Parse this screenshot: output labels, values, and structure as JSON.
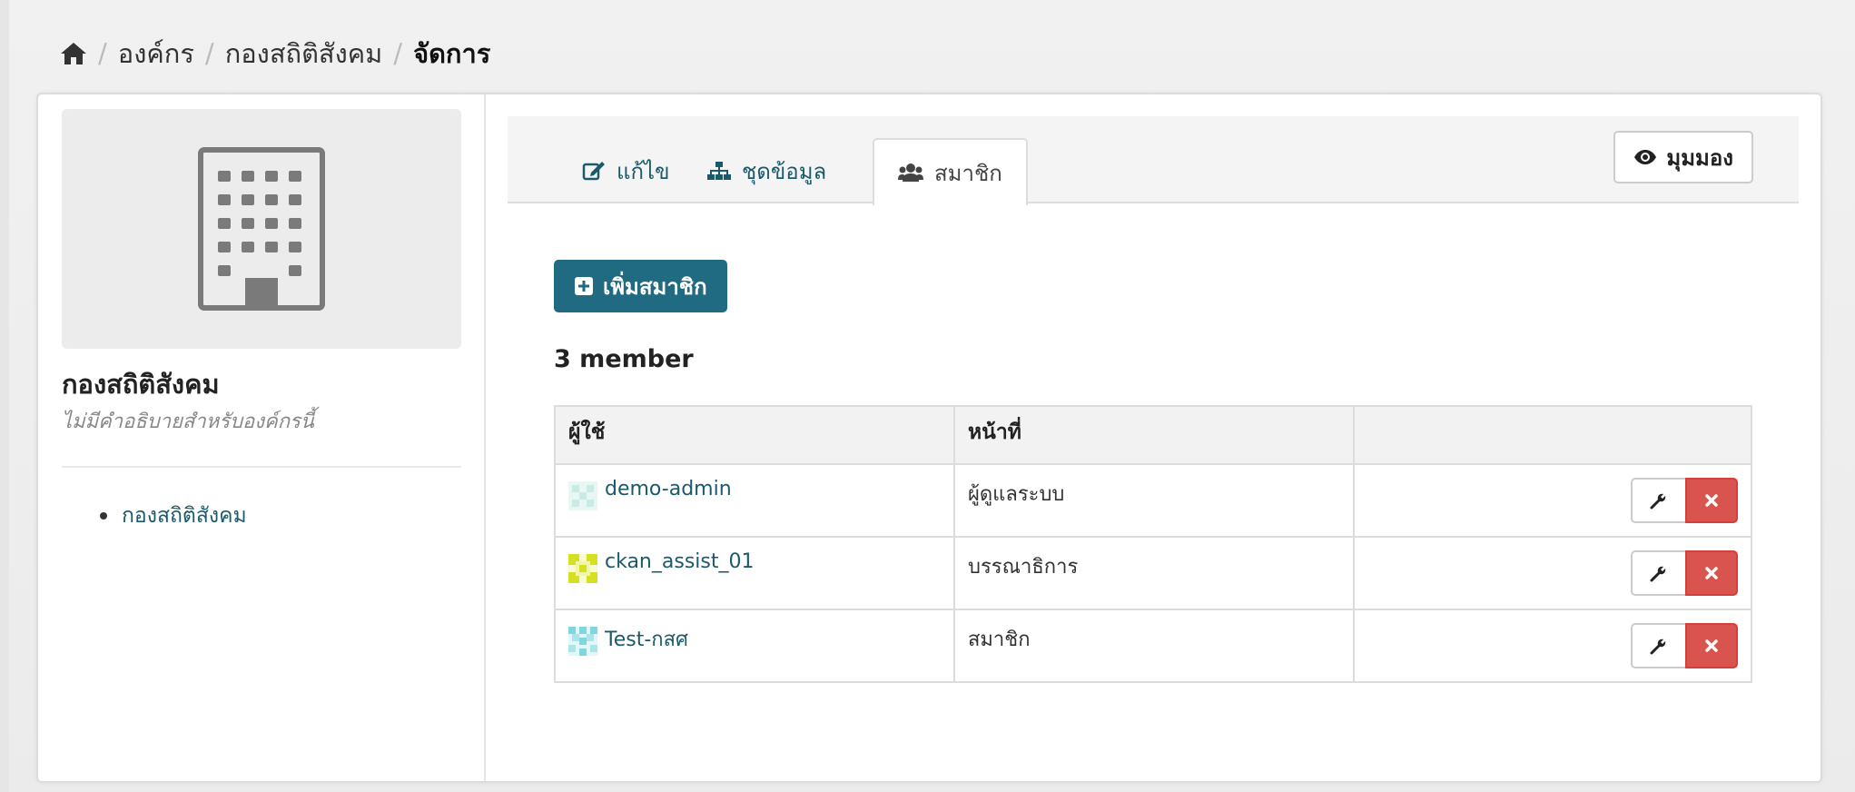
{
  "breadcrumb": {
    "home_icon": "home-icon",
    "items": [
      "องค์กร",
      "กองสถิติสังคม",
      "จัดการ"
    ]
  },
  "sidebar": {
    "org_image_icon": "building-icon",
    "org_title": "กองสถิติสังคม",
    "org_description": "ไม่มีคำอธิบายสำหรับองค์กรนี้",
    "links": [
      "กองสถิติสังคม"
    ]
  },
  "tabs": [
    {
      "label": "แก้ไข",
      "icon": "edit-icon",
      "active": false
    },
    {
      "label": "ชุดข้อมูล",
      "icon": "sitemap-icon",
      "active": false
    },
    {
      "label": "สมาชิก",
      "icon": "users-icon",
      "active": true
    }
  ],
  "view_button": {
    "label": "มุมมอง",
    "icon": "eye-icon"
  },
  "add_member_button": {
    "label": "เพิ่มสมาชิก",
    "icon": "plus-square-icon"
  },
  "member_count": "3 member",
  "table": {
    "headers": [
      "ผู้ใช้",
      "หน้าที่",
      ""
    ],
    "rows": [
      {
        "user": "demo-admin",
        "role": "ผู้ดูแลระบบ"
      },
      {
        "user": "ckan_assist_01",
        "role": "บรรณาธิการ"
      },
      {
        "user": "Test-กสศ",
        "role": "สมาชิก"
      }
    ],
    "edit_icon": "wrench-icon",
    "delete_icon": "times-icon"
  },
  "colors": {
    "accent": "#206b82",
    "link": "#1b5a6a",
    "danger": "#d9534f"
  }
}
